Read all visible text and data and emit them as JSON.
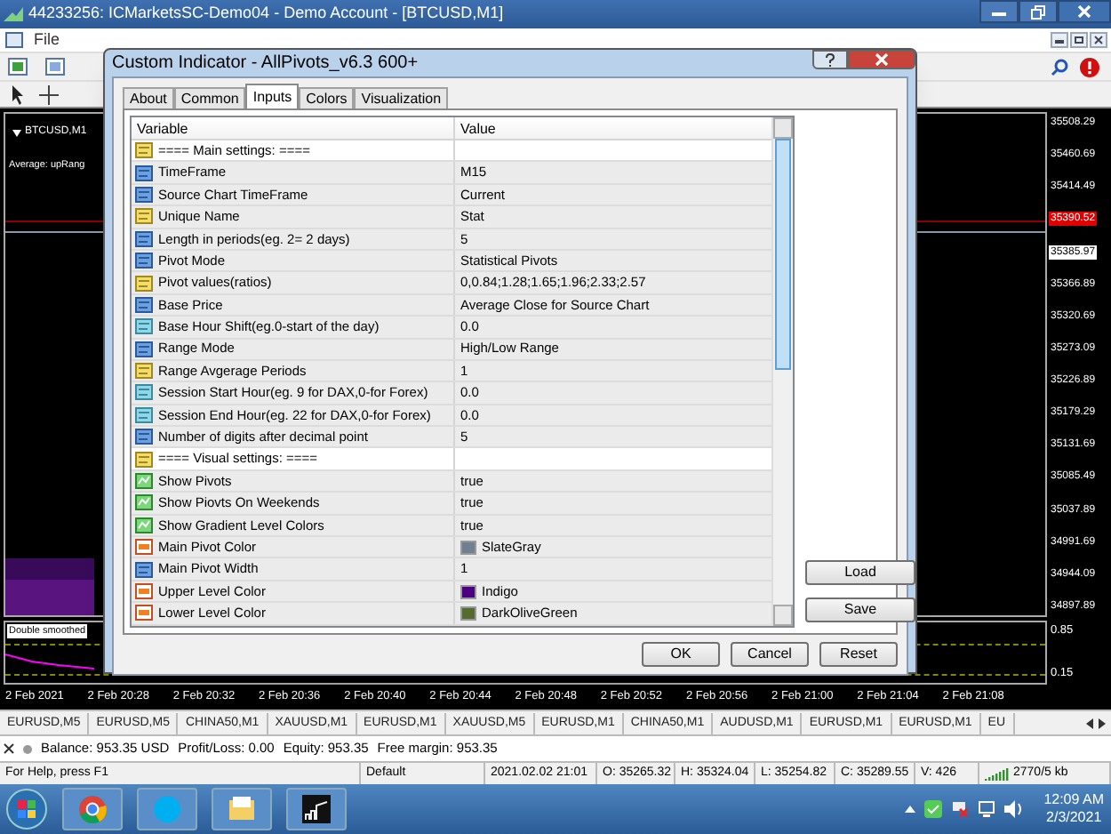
{
  "window": {
    "title": "44233256: ICMarketsSC-Demo04 - Demo Account - [BTCUSD,M1]"
  },
  "menu": [
    "File"
  ],
  "chart": {
    "symbol": "BTCUSD,M1",
    "indicator_label": "Average: upRang",
    "subwindow_label": "Double smoothed",
    "prices": [
      {
        "text": "35508.29",
        "kind": "plain"
      },
      {
        "text": "35460.69",
        "kind": "plain"
      },
      {
        "text": "35414.49",
        "kind": "plain"
      },
      {
        "text": "35390.52",
        "kind": "bid"
      },
      {
        "text": "35385.97",
        "kind": "ask"
      },
      {
        "text": "35366.89",
        "kind": "plain"
      },
      {
        "text": "35320.69",
        "kind": "plain"
      },
      {
        "text": "35273.09",
        "kind": "plain"
      },
      {
        "text": "35226.89",
        "kind": "plain"
      },
      {
        "text": "35179.29",
        "kind": "plain"
      },
      {
        "text": "35131.69",
        "kind": "plain"
      },
      {
        "text": "35085.49",
        "kind": "plain"
      },
      {
        "text": "35037.89",
        "kind": "plain"
      },
      {
        "text": "34991.69",
        "kind": "plain"
      },
      {
        "text": "34944.09",
        "kind": "plain"
      },
      {
        "text": "34897.89",
        "kind": "plain"
      }
    ],
    "sub_levels": [
      "0.85",
      "0.15"
    ],
    "times": [
      "2 Feb 2021",
      "2 Feb 20:28",
      "2 Feb 20:32",
      "2 Feb 20:36",
      "2 Feb 20:40",
      "2 Feb 20:44",
      "2 Feb 20:48",
      "2 Feb 20:52",
      "2 Feb 20:56",
      "2 Feb 21:00",
      "2 Feb 21:04",
      "2 Feb 21:08"
    ]
  },
  "symbol_tabs": [
    "EURUSD,M5",
    "EURUSD,M5",
    "CHINA50,M1",
    "XAUUSD,M1",
    "EURUSD,M1",
    "XAUUSD,M5",
    "EURUSD,M1",
    "CHINA50,M1",
    "AUDUSD,M1",
    "EURUSD,M1",
    "EURUSD,M1",
    "EU"
  ],
  "account": [
    "Balance: 953.35 USD",
    "Profit/Loss: 0.00",
    "Equity: 953.35",
    "Free margin: 953.35"
  ],
  "status_bar": [
    "For Help, press F1",
    "Default",
    "2021.02.02 21:01",
    "O: 35265.32",
    "H: 35324.04",
    "L: 35254.82",
    "C: 35289.55",
    "V: 426",
    "2770/5 kb"
  ],
  "taskbar": {
    "time": "12:09 AM",
    "date": "2/3/2021"
  },
  "dialog": {
    "title": "Custom Indicator - AllPivots_v6.3 600+",
    "tabs": [
      {
        "label": "About",
        "selected": false
      },
      {
        "label": "Common",
        "selected": false
      },
      {
        "label": "Inputs",
        "selected": true
      },
      {
        "label": "Colors",
        "selected": false
      },
      {
        "label": "Visualization",
        "selected": false
      }
    ],
    "columns": [
      "Variable",
      "Value"
    ],
    "rows": [
      {
        "kind": "string",
        "variable": "==== Main settings: ===="
      },
      {
        "kind": "enum",
        "variable": "TimeFrame",
        "value": "M15"
      },
      {
        "kind": "enum",
        "variable": "Source Chart TimeFrame",
        "value": "Current"
      },
      {
        "kind": "string",
        "variable": "Unique Name",
        "value": "Stat"
      },
      {
        "kind": "int",
        "variable": "Length in periods(eg. 2= 2 days)",
        "value": "5"
      },
      {
        "kind": "enum",
        "variable": "Pivot Mode",
        "value": "Statistical Pivots"
      },
      {
        "kind": "string",
        "variable": "Pivot values(ratios)",
        "value": "0,0.84;1.28;1.65;1.96;2.33;2.57"
      },
      {
        "kind": "enum",
        "variable": "Base Price",
        "value": "Average Close for Source Chart"
      },
      {
        "kind": "double",
        "variable": "Base Hour Shift(eg.0-start of the day)",
        "value": "0.0"
      },
      {
        "kind": "enum",
        "variable": "Range Mode",
        "value": "High/Low Range"
      },
      {
        "kind": "string",
        "variable": "Range Avgerage Periods",
        "value": "1"
      },
      {
        "kind": "double",
        "variable": "Session Start Hour(eg. 9 for DAX,0-for Forex)",
        "value": "0.0"
      },
      {
        "kind": "double",
        "variable": "Session End Hour(eg. 22 for DAX,0-for Forex)",
        "value": "0.0"
      },
      {
        "kind": "int",
        "variable": "Number of digits after decimal point",
        "value": "5"
      },
      {
        "kind": "string",
        "variable": "==== Visual settings: ===="
      },
      {
        "kind": "bool",
        "variable": "Show Pivots",
        "value": "true"
      },
      {
        "kind": "bool",
        "variable": "Show Piovts On Weekends",
        "value": "true"
      },
      {
        "kind": "bool",
        "variable": "Show Gradient Level Colors",
        "value": "true"
      },
      {
        "kind": "color",
        "variable": "Main Pivot Color",
        "value": "SlateGray",
        "color": "#708090"
      },
      {
        "kind": "int",
        "variable": "Main Pivot Width",
        "value": "1"
      },
      {
        "kind": "color",
        "variable": "Upper Level Color",
        "value": "Indigo",
        "color": "#4b0082"
      },
      {
        "kind": "color",
        "variable": "Lower Level Color",
        "value": "DarkOliveGreen",
        "color": "#556b2f"
      }
    ],
    "side_buttons": [
      "Load",
      "Save"
    ],
    "buttons": [
      "OK",
      "Cancel",
      "Reset"
    ]
  }
}
